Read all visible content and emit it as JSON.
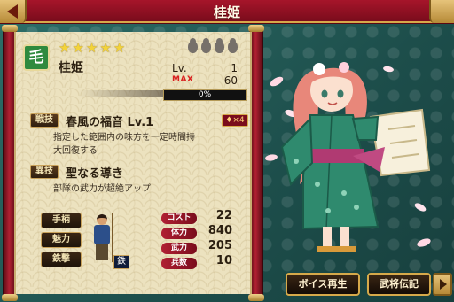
{
  "header": {
    "title": "桂姫"
  },
  "character": {
    "attribute": "毛",
    "name": "桂姫",
    "stars": 5,
    "gourds": 4,
    "level_label": "Lv.",
    "level": "1",
    "max_label": "MAX",
    "max_level": "60",
    "exp_text": "0%",
    "exp_fraction": 0
  },
  "skills": {
    "battle_tag": "戦技",
    "battle_name": "春風の福音 Lv.1",
    "battle_cost": "×4",
    "battle_desc_1": "指定した範囲内の味方を一定時間持",
    "battle_desc_2": "大回復する",
    "special_tag": "異技",
    "special_name": "聖なる導き",
    "special_desc": "部隊の武力が超絶アップ"
  },
  "tabs": {
    "tegara": "手柄",
    "miryoku": "魅力",
    "kyoka": "鉄撃"
  },
  "unit": {
    "badge": "鉄"
  },
  "stats": [
    {
      "label": "コスト",
      "value": "22"
    },
    {
      "label": "体力",
      "value": "840"
    },
    {
      "label": "武力",
      "value": "205"
    },
    {
      "label": "兵数",
      "value": "10"
    }
  ],
  "buttons": {
    "voice": "ボイス再生",
    "legend": "武将伝記"
  },
  "colors": {
    "title_red": "#a6152a",
    "gold": "#d6a94a",
    "background_teal": "#1f5a57",
    "attr_green": "#2f8a3e"
  },
  "icons": [
    "back-arrow-icon",
    "attribute-icon",
    "star-icon",
    "gourd-icon",
    "fire-icon",
    "forward-arrow-icon"
  ]
}
